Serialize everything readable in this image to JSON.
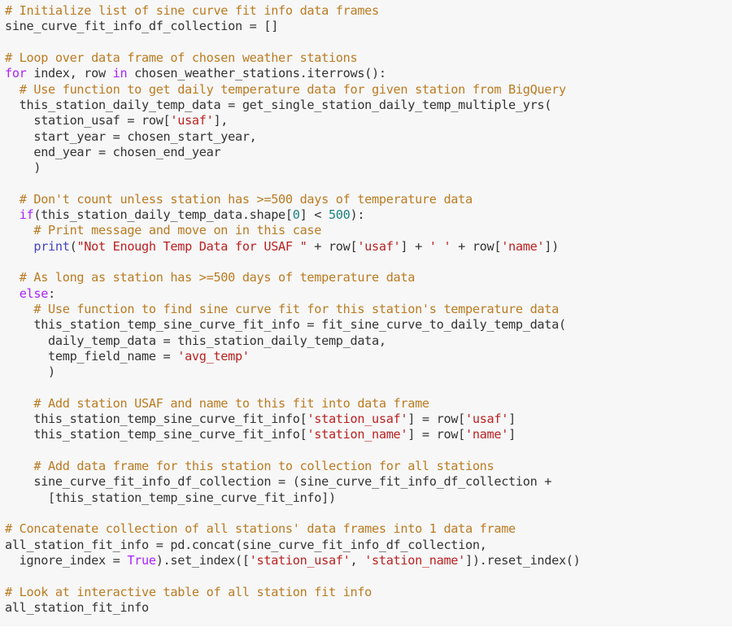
{
  "editor": {
    "name": "python-code-block",
    "language": "python",
    "background_color": "#f7f7f7",
    "plain_text_color": "#333333",
    "colors": {
      "comment": "#BA7B22",
      "keyword": "#AA22FF",
      "string": "#BA2121",
      "number": "#1A7F7F",
      "builtin": "#4343C3",
      "plain": "#333333"
    }
  },
  "code": {
    "lines": [
      [
        {
          "t": "c",
          "v": "# Initialize list of sine curve fit info data frames"
        }
      ],
      [
        {
          "t": "p",
          "v": "sine_curve_fit_info_df_collection = []"
        }
      ],
      [],
      [
        {
          "t": "c",
          "v": "# Loop over data frame of chosen weather stations"
        }
      ],
      [
        {
          "t": "k",
          "v": "for"
        },
        {
          "t": "p",
          "v": " index, row "
        },
        {
          "t": "k",
          "v": "in"
        },
        {
          "t": "p",
          "v": " chosen_weather_stations.iterrows():"
        }
      ],
      [
        {
          "t": "p",
          "v": "  "
        },
        {
          "t": "c",
          "v": "# Use function to get daily temperature data for given station from BigQuery"
        }
      ],
      [
        {
          "t": "p",
          "v": "  this_station_daily_temp_data = get_single_station_daily_temp_multiple_yrs("
        }
      ],
      [
        {
          "t": "p",
          "v": "    station_usaf = row["
        },
        {
          "t": "s",
          "v": "'usaf'"
        },
        {
          "t": "p",
          "v": "],"
        }
      ],
      [
        {
          "t": "p",
          "v": "    start_year = chosen_start_year,"
        }
      ],
      [
        {
          "t": "p",
          "v": "    end_year = chosen_end_year"
        }
      ],
      [
        {
          "t": "p",
          "v": "    )"
        }
      ],
      [],
      [
        {
          "t": "p",
          "v": "  "
        },
        {
          "t": "c",
          "v": "# Don't count unless station has >=500 days of temperature data"
        }
      ],
      [
        {
          "t": "p",
          "v": "  "
        },
        {
          "t": "k",
          "v": "if"
        },
        {
          "t": "p",
          "v": "(this_station_daily_temp_data.shape["
        },
        {
          "t": "n",
          "v": "0"
        },
        {
          "t": "p",
          "v": "] < "
        },
        {
          "t": "n",
          "v": "500"
        },
        {
          "t": "p",
          "v": "):"
        }
      ],
      [
        {
          "t": "p",
          "v": "    "
        },
        {
          "t": "c",
          "v": "# Print message and move on in this case"
        }
      ],
      [
        {
          "t": "p",
          "v": "    "
        },
        {
          "t": "b",
          "v": "print"
        },
        {
          "t": "p",
          "v": "("
        },
        {
          "t": "s",
          "v": "\"Not Enough Temp Data for USAF \""
        },
        {
          "t": "p",
          "v": " + row["
        },
        {
          "t": "s",
          "v": "'usaf'"
        },
        {
          "t": "p",
          "v": "] + "
        },
        {
          "t": "s",
          "v": "' '"
        },
        {
          "t": "p",
          "v": " + row["
        },
        {
          "t": "s",
          "v": "'name'"
        },
        {
          "t": "p",
          "v": "])"
        }
      ],
      [],
      [
        {
          "t": "p",
          "v": "  "
        },
        {
          "t": "c",
          "v": "# As long as station has >=500 days of temperature data"
        }
      ],
      [
        {
          "t": "p",
          "v": "  "
        },
        {
          "t": "k",
          "v": "else"
        },
        {
          "t": "p",
          "v": ":"
        }
      ],
      [
        {
          "t": "p",
          "v": "    "
        },
        {
          "t": "c",
          "v": "# Use function to find sine curve fit for this station's temperature data"
        }
      ],
      [
        {
          "t": "p",
          "v": "    this_station_temp_sine_curve_fit_info = fit_sine_curve_to_daily_temp_data("
        }
      ],
      [
        {
          "t": "p",
          "v": "      daily_temp_data = this_station_daily_temp_data,"
        }
      ],
      [
        {
          "t": "p",
          "v": "      temp_field_name = "
        },
        {
          "t": "s",
          "v": "'avg_temp'"
        }
      ],
      [
        {
          "t": "p",
          "v": "      )"
        }
      ],
      [],
      [
        {
          "t": "p",
          "v": "    "
        },
        {
          "t": "c",
          "v": "# Add station USAF and name to this fit into data frame"
        }
      ],
      [
        {
          "t": "p",
          "v": "    this_station_temp_sine_curve_fit_info["
        },
        {
          "t": "s",
          "v": "'station_usaf'"
        },
        {
          "t": "p",
          "v": "] = row["
        },
        {
          "t": "s",
          "v": "'usaf'"
        },
        {
          "t": "p",
          "v": "]"
        }
      ],
      [
        {
          "t": "p",
          "v": "    this_station_temp_sine_curve_fit_info["
        },
        {
          "t": "s",
          "v": "'station_name'"
        },
        {
          "t": "p",
          "v": "] = row["
        },
        {
          "t": "s",
          "v": "'name'"
        },
        {
          "t": "p",
          "v": "]"
        }
      ],
      [],
      [
        {
          "t": "p",
          "v": "    "
        },
        {
          "t": "c",
          "v": "# Add data frame for this station to collection for all stations"
        }
      ],
      [
        {
          "t": "p",
          "v": "    sine_curve_fit_info_df_collection = (sine_curve_fit_info_df_collection +"
        }
      ],
      [
        {
          "t": "p",
          "v": "      [this_station_temp_sine_curve_fit_info])"
        }
      ],
      [],
      [
        {
          "t": "c",
          "v": "# Concatenate collection of all stations' data frames into 1 data frame"
        }
      ],
      [
        {
          "t": "p",
          "v": "all_station_fit_info = pd.concat(sine_curve_fit_info_df_collection,"
        }
      ],
      [
        {
          "t": "p",
          "v": "  ignore_index = "
        },
        {
          "t": "k",
          "v": "True"
        },
        {
          "t": "p",
          "v": ").set_index(["
        },
        {
          "t": "s",
          "v": "'station_usaf'"
        },
        {
          "t": "p",
          "v": ", "
        },
        {
          "t": "s",
          "v": "'station_name'"
        },
        {
          "t": "p",
          "v": "]).reset_index()"
        }
      ],
      [],
      [
        {
          "t": "c",
          "v": "# Look at interactive table of all station fit info"
        }
      ],
      [
        {
          "t": "p",
          "v": "all_station_fit_info"
        }
      ]
    ]
  }
}
